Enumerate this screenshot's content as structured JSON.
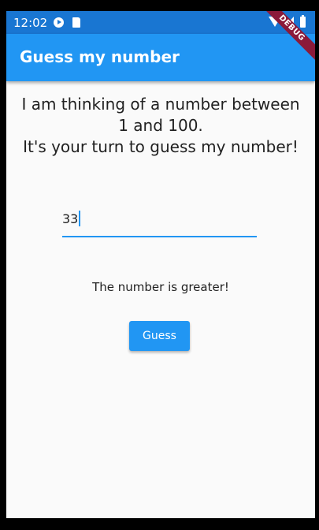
{
  "status_bar": {
    "time": "12:02",
    "icons": [
      "play-protect-icon",
      "sd-card-icon",
      "wifi-icon",
      "signal-icon",
      "battery-icon"
    ]
  },
  "app_bar": {
    "title": "Guess my number",
    "debug_banner": "DEBUG"
  },
  "main": {
    "intro_line_1": "I am thinking of a number between 1 and 100.",
    "intro_line_2": "It's your turn to guess my number!",
    "guess_input_value": "33",
    "feedback": "The number is greater!",
    "guess_button_label": "Guess"
  },
  "colors": {
    "primary": "#2196f3",
    "status_bar": "#1976d2",
    "background": "#fafafa",
    "debug_banner": "#8b1a3a"
  }
}
